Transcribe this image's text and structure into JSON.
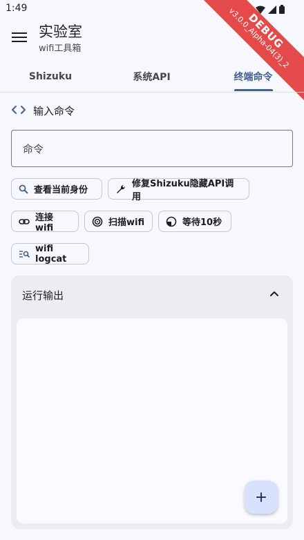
{
  "status": {
    "time": "1:49"
  },
  "debug": {
    "label": "DEBUG",
    "version": "v3.0.0_Alpha-04(3)_2"
  },
  "app_bar": {
    "title": "实验室",
    "subtitle": "wifi工具箱"
  },
  "tabs": [
    {
      "label": "Shizuku",
      "active": false
    },
    {
      "label": "系统API",
      "active": false
    },
    {
      "label": "终端命令",
      "active": true
    }
  ],
  "section": {
    "title": "输入命令",
    "icon": "code-icon"
  },
  "command_input": {
    "placeholder": "命令",
    "value": ""
  },
  "chips": [
    {
      "label": "查看当前身份",
      "icon": "search-icon"
    },
    {
      "label": "修复Shizuku隐藏API调用",
      "icon": "wrench-icon"
    },
    {
      "label": "连接wifi",
      "icon": "link-icon"
    },
    {
      "label": "扫描wifi",
      "icon": "radar-icon"
    },
    {
      "label": "等待10秒",
      "icon": "timer-icon"
    },
    {
      "label": "wifi logcat",
      "icon": "log-search-icon"
    }
  ],
  "output": {
    "title": "运行输出",
    "expanded": true,
    "content": ""
  },
  "fab": {
    "icon": "plus-icon"
  },
  "colors": {
    "accent": "#415f91",
    "fab_bg": "#d8e2ff",
    "debug_banner": "#e54a4a",
    "background": "#f7f8fd"
  }
}
